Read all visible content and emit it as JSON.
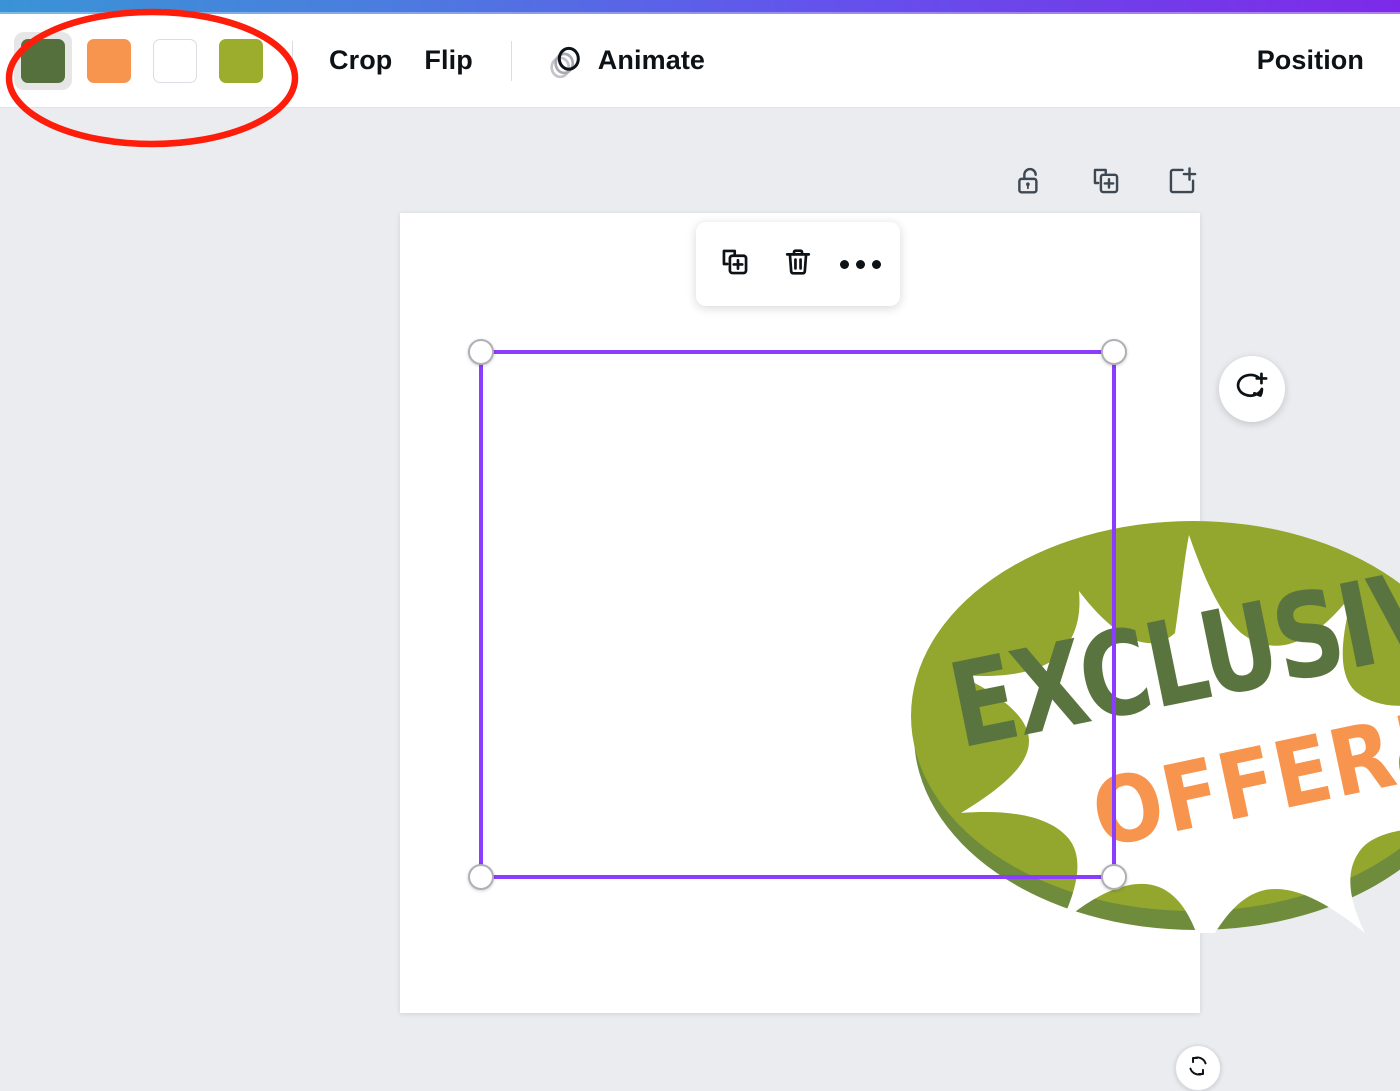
{
  "app": {
    "background_color": "#ebecf0",
    "accent_purple": "#8b3dff"
  },
  "top_bar": {
    "gradient_from": "#3a93d6",
    "gradient_to": "#7d2ae8"
  },
  "toolbar": {
    "swatches": [
      {
        "name": "dark-olive-green",
        "color": "#55703c",
        "selected": true
      },
      {
        "name": "orange",
        "color": "#f7944d",
        "selected": false
      },
      {
        "name": "white",
        "color": "#ffffff",
        "selected": false
      },
      {
        "name": "yellow-green",
        "color": "#9cac2c",
        "selected": false
      }
    ],
    "crop_label": "Crop",
    "flip_label": "Flip",
    "animate_label": "Animate",
    "position_label": "Position"
  },
  "page_tools": [
    {
      "name": "lock-toggle",
      "icon": "unlock-icon"
    },
    {
      "name": "duplicate-page",
      "icon": "duplicate-page-icon"
    },
    {
      "name": "add-page",
      "icon": "add-page-icon"
    }
  ],
  "element_toolbar": [
    {
      "name": "duplicate-element",
      "icon": "duplicate-icon"
    },
    {
      "name": "delete-element",
      "icon": "trash-icon"
    },
    {
      "name": "more-options",
      "icon": "ellipsis-icon"
    }
  ],
  "comment_button": {
    "name": "add-comment",
    "icon": "comment-plus-icon"
  },
  "rotate_handle": {
    "name": "rotate-element",
    "icon": "rotate-icon"
  },
  "selection": {
    "handles": [
      "top-left",
      "top-right",
      "bottom-left",
      "bottom-right"
    ],
    "border_color": "#8b3dff"
  },
  "artwork": {
    "title": "EXCLUSIVE",
    "subtitle": "OFFER!",
    "ellipse_color": "#93a62d",
    "shadow_color": "#6f8c3d",
    "burst_color": "#ffffff",
    "title_color": "#5a7440",
    "subtitle_color": "#f7944d"
  },
  "annotation": {
    "shape": "ellipse",
    "color": "#fc1d0a",
    "target": "color-swatches"
  }
}
